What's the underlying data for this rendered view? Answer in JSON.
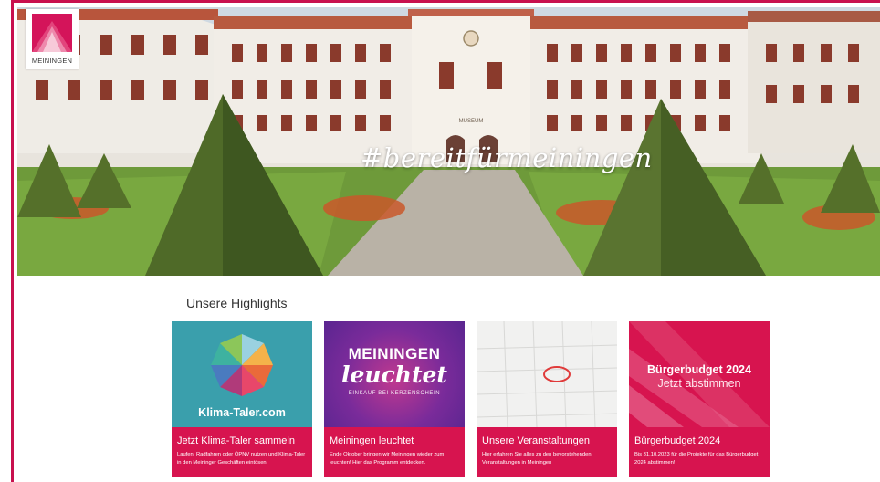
{
  "brand": {
    "logo_text": "MEININGEN",
    "accent_color": "#d7144f"
  },
  "hero": {
    "hashtag": "#bereitfürmeiningen",
    "building_sign": "MUSEUM"
  },
  "highlights": {
    "heading": "Unsere Highlights",
    "cards": [
      {
        "image_text": "Klima-Taler.com",
        "title": "Jetzt Klima-Taler sammeln",
        "description": "Laufen, Radfahren oder ÖPNV nutzen und Klima-Taler in den Meininger Geschäften eintösen"
      },
      {
        "image_text_top": "MEININGEN",
        "image_text_script": "leuchtet",
        "image_text_sub": "– EINKAUF BEI KERZENSCHEIN –",
        "title": "Meiningen leuchtet",
        "description": "Ende Oktober bringen wir Meiningen wieder zum leuchten! Hier das Programm entdecken."
      },
      {
        "title": "Unsere Veranstaltungen",
        "description": "Hier erfahren Sie alles zu den bevorstehenden Veranstaltungen in Meiningen"
      },
      {
        "image_text_title": "Bürgerbudget 2024",
        "image_text_sub": "Jetzt abstimmen",
        "title": "Bürgerbudget 2024",
        "description": "Bis 31.10.2023 für die Projekte für das Bürgerbudget 2024 abstimmen!"
      }
    ]
  },
  "icons": {
    "logo": "meiningen-crest-icon",
    "klima": "klima-taler-wheel-icon",
    "calendar": "calendar-icon"
  }
}
